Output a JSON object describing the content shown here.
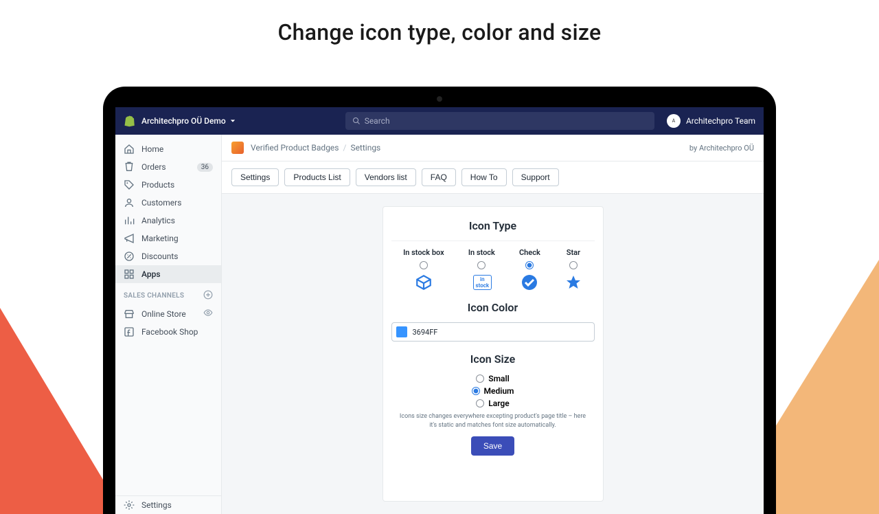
{
  "headline": "Change icon type, color and size",
  "topbar": {
    "store_name": "Architechpro OÜ Demo",
    "search_placeholder": "Search",
    "team_name": "Architechpro Team"
  },
  "sidebar": {
    "items": [
      {
        "label": "Home"
      },
      {
        "label": "Orders",
        "badge": "36"
      },
      {
        "label": "Products"
      },
      {
        "label": "Customers"
      },
      {
        "label": "Analytics"
      },
      {
        "label": "Marketing"
      },
      {
        "label": "Discounts"
      },
      {
        "label": "Apps"
      }
    ],
    "section_label": "SALES CHANNELS",
    "channels": [
      {
        "label": "Online Store"
      },
      {
        "label": "Facebook Shop"
      }
    ],
    "settings_label": "Settings"
  },
  "breadcrumb": {
    "app": "Verified Product Badges",
    "page": "Settings",
    "byline": "by Architechpro OÜ"
  },
  "tabs": [
    "Settings",
    "Products List",
    "Vendors list",
    "FAQ",
    "How To",
    "Support"
  ],
  "panel": {
    "icon_type_title": "Icon Type",
    "types": [
      {
        "label": "In stock box"
      },
      {
        "label": "In stock",
        "pill": "in stock"
      },
      {
        "label": "Check"
      },
      {
        "label": "Star"
      }
    ],
    "selected_type_index": 2,
    "icon_color_title": "Icon Color",
    "icon_color_hex": "3694FF",
    "swatch_css": "#3694FF",
    "icon_size_title": "Icon Size",
    "sizes": [
      "Small",
      "Medium",
      "Large"
    ],
    "selected_size_index": 1,
    "hint": "Icons size changes everywhere excepting product's page title – here it's static and matches font size automatically.",
    "save_label": "Save"
  }
}
